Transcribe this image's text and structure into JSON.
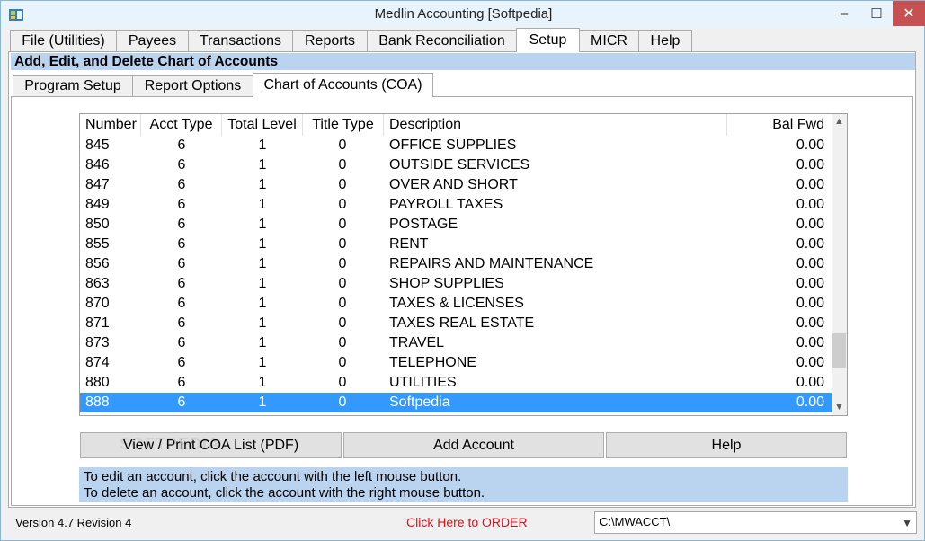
{
  "window": {
    "title": "Medlin Accounting [Softpedia]",
    "minimize": "–",
    "maximize": "☐",
    "close": "✕"
  },
  "tabs": [
    "File (Utilities)",
    "Payees",
    "Transactions",
    "Reports",
    "Bank Reconciliation",
    "Setup",
    "MICR",
    "Help"
  ],
  "active_tab": "Setup",
  "section_title": "Add, Edit, and Delete Chart of Accounts",
  "subtabs": [
    "Program Setup",
    "Report Options",
    "Chart of Accounts (COA)"
  ],
  "active_subtab": "Chart of Accounts (COA)",
  "grid": {
    "headers": [
      "Number",
      "Acct Type",
      "Total Level",
      "Title Type",
      "Description",
      "Bal Fwd"
    ],
    "rows": [
      [
        "845",
        "6",
        "1",
        "0",
        "OFFICE SUPPLIES",
        "0.00"
      ],
      [
        "846",
        "6",
        "1",
        "0",
        "OUTSIDE SERVICES",
        "0.00"
      ],
      [
        "847",
        "6",
        "1",
        "0",
        "OVER AND SHORT",
        "0.00"
      ],
      [
        "849",
        "6",
        "1",
        "0",
        "PAYROLL TAXES",
        "0.00"
      ],
      [
        "850",
        "6",
        "1",
        "0",
        "POSTAGE",
        "0.00"
      ],
      [
        "855",
        "6",
        "1",
        "0",
        "RENT",
        "0.00"
      ],
      [
        "856",
        "6",
        "1",
        "0",
        "REPAIRS AND MAINTENANCE",
        "0.00"
      ],
      [
        "863",
        "6",
        "1",
        "0",
        "SHOP SUPPLIES",
        "0.00"
      ],
      [
        "870",
        "6",
        "1",
        "0",
        "TAXES & LICENSES",
        "0.00"
      ],
      [
        "871",
        "6",
        "1",
        "0",
        "TAXES REAL ESTATE",
        "0.00"
      ],
      [
        "873",
        "6",
        "1",
        "0",
        "TRAVEL",
        "0.00"
      ],
      [
        "874",
        "6",
        "1",
        "0",
        "TELEPHONE",
        "0.00"
      ],
      [
        "880",
        "6",
        "1",
        "0",
        "UTILITIES",
        "0.00"
      ],
      [
        "888",
        "6",
        "1",
        "0",
        "Softpedia",
        "0.00"
      ]
    ],
    "selected_number": "888"
  },
  "buttons": {
    "view_print": "View / Print COA List (PDF)",
    "add_account": "Add Account",
    "help": "Help"
  },
  "help_text": {
    "line1": "To edit an account, click the account with the left mouse button.",
    "line2": "To delete an account, click the account with the right mouse button."
  },
  "status": {
    "version": "Version 4.7 Revision 4",
    "order_link": "Click Here to ORDER",
    "path": "C:\\MWACCT\\"
  },
  "watermark": "SOFTPEDIA",
  "colors": {
    "header_band": "#bad3ee",
    "selection": "#3399ff",
    "order_link": "#e0101a",
    "close_button": "#c75050"
  },
  "icons": {
    "app": "app-icon",
    "scroll_up": "chevron-up-icon",
    "scroll_down": "chevron-down-icon",
    "dropdown": "chevron-down-icon"
  }
}
